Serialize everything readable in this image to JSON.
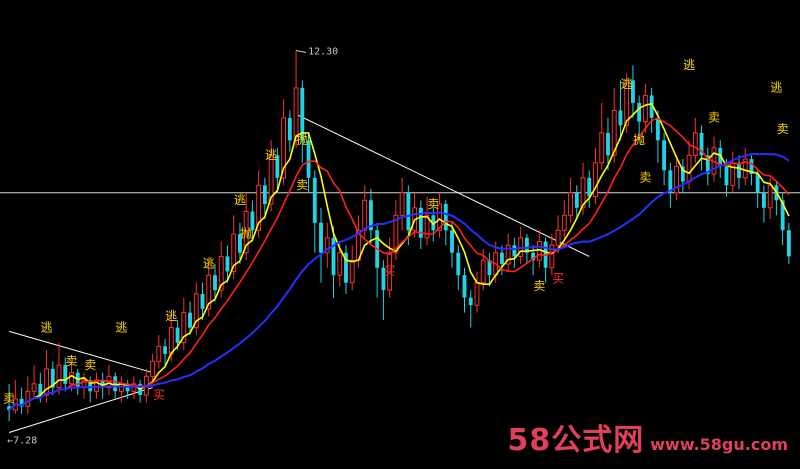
{
  "chart_data": {
    "type": "candlestick",
    "title": "",
    "high_label": "12.30",
    "low_label": "←7.28",
    "ylim": [
      7.1,
      12.6
    ],
    "reference_price": 10.4,
    "colors": {
      "background": "#000000",
      "up_candle": "#ff3030",
      "down_candle": "#22d3e6",
      "ma_fast": "#ffff00",
      "ma_mid": "#ff2020",
      "ma_slow": "#2430ff",
      "trend_line": "#ffffff",
      "signal_sell": "#ffd700",
      "signal_buy": "#ff3030"
    },
    "candles": [
      [
        7.55,
        7.5,
        7.85,
        7.35
      ],
      [
        7.5,
        7.65,
        7.9,
        7.45
      ],
      [
        7.65,
        7.55,
        7.8,
        7.45
      ],
      [
        7.55,
        7.75,
        7.95,
        7.45
      ],
      [
        7.75,
        7.85,
        8.1,
        7.65
      ],
      [
        7.85,
        7.7,
        8.0,
        7.6
      ],
      [
        7.7,
        8.05,
        8.3,
        7.6
      ],
      [
        8.05,
        7.8,
        8.15,
        7.7
      ],
      [
        7.8,
        8.1,
        8.4,
        7.7
      ],
      [
        8.1,
        7.85,
        8.2,
        7.75
      ],
      [
        7.85,
        8.0,
        8.15,
        7.75
      ],
      [
        8.0,
        7.8,
        8.05,
        7.7
      ],
      [
        7.8,
        7.9,
        8.0,
        7.65
      ],
      [
        7.9,
        7.75,
        7.95,
        7.6
      ],
      [
        7.75,
        7.9,
        8.0,
        7.65
      ],
      [
        7.9,
        7.8,
        8.0,
        7.65
      ],
      [
        7.8,
        7.95,
        8.1,
        7.7
      ],
      [
        7.95,
        7.75,
        8.0,
        7.65
      ],
      [
        7.75,
        7.85,
        7.95,
        7.6
      ],
      [
        7.85,
        7.75,
        7.9,
        7.65
      ],
      [
        7.75,
        7.85,
        7.95,
        7.65
      ],
      [
        7.85,
        7.7,
        7.9,
        7.6
      ],
      [
        7.7,
        7.95,
        8.05,
        7.6
      ],
      [
        7.95,
        8.15,
        8.25,
        7.85
      ],
      [
        8.15,
        8.35,
        8.5,
        8.05
      ],
      [
        8.35,
        8.25,
        8.45,
        8.1
      ],
      [
        8.25,
        8.6,
        8.75,
        8.15
      ],
      [
        8.6,
        8.4,
        8.7,
        8.3
      ],
      [
        8.4,
        8.8,
        9.0,
        8.3
      ],
      [
        8.8,
        8.6,
        8.95,
        8.5
      ],
      [
        8.6,
        9.05,
        9.2,
        8.5
      ],
      [
        9.05,
        8.85,
        9.2,
        8.7
      ],
      [
        8.85,
        9.3,
        9.5,
        8.75
      ],
      [
        9.3,
        9.1,
        9.45,
        8.95
      ],
      [
        9.1,
        9.55,
        9.75,
        9.0
      ],
      [
        9.55,
        9.35,
        9.7,
        9.2
      ],
      [
        9.35,
        9.85,
        10.1,
        9.25
      ],
      [
        9.85,
        9.6,
        10.0,
        9.45
      ],
      [
        9.6,
        10.15,
        10.4,
        9.5
      ],
      [
        10.15,
        9.9,
        10.3,
        9.75
      ],
      [
        9.9,
        10.5,
        10.7,
        9.8
      ],
      [
        10.5,
        10.25,
        10.6,
        10.05
      ],
      [
        10.25,
        10.9,
        11.1,
        10.15
      ],
      [
        10.9,
        10.6,
        11.0,
        10.4
      ],
      [
        10.6,
        11.4,
        11.65,
        10.5
      ],
      [
        11.4,
        11.1,
        11.5,
        10.95
      ],
      [
        11.1,
        11.8,
        12.3,
        11.0
      ],
      [
        11.8,
        11.1,
        11.9,
        10.8
      ],
      [
        11.1,
        10.6,
        11.2,
        10.4
      ],
      [
        10.6,
        10.0,
        10.7,
        9.6
      ],
      [
        10.0,
        9.6,
        10.2,
        9.2
      ],
      [
        9.6,
        9.8,
        10.0,
        9.4
      ],
      [
        9.8,
        9.3,
        9.95,
        9.0
      ],
      [
        9.3,
        9.6,
        9.75,
        9.15
      ],
      [
        9.6,
        9.2,
        9.7,
        9.05
      ],
      [
        9.2,
        9.5,
        9.7,
        9.1
      ],
      [
        9.5,
        9.9,
        10.1,
        9.4
      ],
      [
        9.9,
        10.3,
        10.5,
        9.8
      ],
      [
        10.3,
        9.9,
        10.45,
        9.7
      ],
      [
        9.9,
        9.4,
        10.0,
        9.0
      ],
      [
        9.4,
        9.1,
        9.5,
        8.7
      ],
      [
        9.1,
        9.6,
        9.8,
        9.0
      ],
      [
        9.6,
        10.1,
        10.3,
        9.5
      ],
      [
        10.1,
        10.4,
        10.6,
        9.9
      ],
      [
        10.4,
        9.9,
        10.5,
        9.7
      ],
      [
        9.9,
        10.2,
        10.4,
        9.8
      ],
      [
        10.2,
        9.8,
        10.3,
        9.65
      ],
      [
        9.8,
        10.1,
        10.35,
        9.7
      ],
      [
        10.1,
        9.9,
        10.2,
        9.75
      ],
      [
        9.9,
        10.25,
        10.4,
        9.8
      ],
      [
        10.25,
        9.9,
        10.3,
        9.7
      ],
      [
        9.9,
        9.6,
        10.0,
        9.4
      ],
      [
        9.6,
        9.3,
        9.7,
        9.1
      ],
      [
        9.3,
        9.0,
        9.4,
        8.8
      ],
      [
        9.0,
        8.9,
        9.1,
        8.6
      ],
      [
        8.9,
        9.2,
        9.35,
        8.8
      ],
      [
        9.2,
        9.5,
        9.65,
        9.1
      ],
      [
        9.5,
        9.3,
        9.6,
        9.15
      ],
      [
        9.3,
        9.6,
        9.75,
        9.2
      ],
      [
        9.6,
        9.45,
        9.7,
        9.3
      ],
      [
        9.45,
        9.7,
        9.85,
        9.35
      ],
      [
        9.7,
        9.55,
        9.8,
        9.4
      ],
      [
        9.55,
        9.8,
        9.95,
        9.45
      ],
      [
        9.8,
        9.6,
        9.85,
        9.45
      ],
      [
        9.6,
        9.5,
        9.7,
        9.3
      ],
      [
        9.5,
        9.75,
        9.9,
        9.4
      ],
      [
        9.75,
        9.4,
        9.8,
        9.2
      ],
      [
        9.4,
        9.7,
        9.85,
        9.3
      ],
      [
        9.7,
        9.9,
        10.1,
        9.6
      ],
      [
        9.9,
        10.1,
        10.3,
        9.8
      ],
      [
        10.1,
        10.4,
        10.6,
        10.0
      ],
      [
        10.4,
        10.2,
        10.5,
        10.05
      ],
      [
        10.2,
        10.6,
        10.8,
        10.1
      ],
      [
        10.6,
        10.35,
        10.7,
        10.2
      ],
      [
        10.35,
        10.8,
        11.0,
        10.25
      ],
      [
        10.8,
        11.2,
        11.6,
        10.7
      ],
      [
        11.2,
        10.9,
        11.4,
        10.7
      ],
      [
        10.9,
        11.5,
        11.8,
        10.8
      ],
      [
        11.5,
        11.3,
        11.9,
        11.1
      ],
      [
        11.3,
        11.9,
        12.0,
        11.2
      ],
      [
        11.9,
        11.6,
        12.1,
        11.4
      ],
      [
        11.6,
        11.35,
        11.7,
        11.1
      ],
      [
        11.35,
        11.7,
        11.85,
        11.2
      ],
      [
        11.7,
        11.4,
        11.8,
        11.2
      ],
      [
        11.4,
        11.1,
        11.5,
        10.8
      ],
      [
        11.1,
        10.7,
        11.2,
        10.5
      ],
      [
        10.7,
        10.4,
        10.8,
        10.2
      ],
      [
        10.4,
        10.75,
        10.9,
        10.3
      ],
      [
        10.75,
        10.55,
        10.85,
        10.4
      ],
      [
        10.55,
        10.9,
        11.1,
        10.45
      ],
      [
        10.9,
        11.2,
        11.4,
        10.8
      ],
      [
        11.2,
        10.9,
        11.3,
        10.7
      ],
      [
        10.9,
        10.65,
        11.0,
        10.5
      ],
      [
        10.65,
        11.0,
        11.15,
        10.55
      ],
      [
        11.0,
        10.75,
        11.1,
        10.6
      ],
      [
        10.75,
        10.5,
        10.85,
        10.35
      ],
      [
        10.5,
        10.8,
        10.95,
        10.4
      ],
      [
        10.8,
        10.6,
        10.9,
        10.45
      ],
      [
        10.6,
        10.85,
        11.0,
        10.5
      ],
      [
        10.85,
        10.65,
        10.9,
        10.5
      ],
      [
        10.65,
        10.4,
        10.7,
        10.2
      ],
      [
        10.4,
        10.2,
        10.5,
        10.0
      ],
      [
        10.2,
        10.5,
        10.6,
        10.05
      ],
      [
        10.5,
        10.3,
        10.55,
        10.1
      ],
      [
        10.3,
        9.9,
        10.4,
        9.7
      ],
      [
        9.9,
        9.55,
        10.0,
        9.45
      ]
    ],
    "moving_averages": [
      {
        "name": "",
        "color": "#ffff00",
        "period": 5
      },
      {
        "name": "",
        "color": "#ff2020",
        "period": 10
      },
      {
        "name": "",
        "color": "#2430ff",
        "period": 30
      }
    ],
    "trend_lines": [
      {
        "from": [
          0,
          8.55
        ],
        "to": [
          23,
          8.0
        ]
      },
      {
        "from": [
          0,
          7.2
        ],
        "to": [
          23,
          7.8
        ]
      },
      {
        "from": [
          46,
          11.45
        ],
        "to": [
          93,
          9.55
        ]
      }
    ],
    "signals": [
      {
        "text": "卖",
        "index": 0,
        "price": 7.6,
        "kind": "sell"
      },
      {
        "text": "逃",
        "index": 6,
        "price": 8.55,
        "kind": "sell"
      },
      {
        "text": "卖",
        "index": 10,
        "price": 8.1,
        "kind": "sell"
      },
      {
        "text": "卖",
        "index": 13,
        "price": 8.05,
        "kind": "sell"
      },
      {
        "text": "逃",
        "index": 18,
        "price": 8.55,
        "kind": "sell"
      },
      {
        "text": "买",
        "index": 24,
        "price": 7.65,
        "kind": "buy"
      },
      {
        "text": "逃",
        "index": 26,
        "price": 8.7,
        "kind": "sell"
      },
      {
        "text": "逃",
        "index": 32,
        "price": 9.4,
        "kind": "sell"
      },
      {
        "text": "抛",
        "index": 38,
        "price": 9.8,
        "kind": "sell"
      },
      {
        "text": "逃",
        "index": 37,
        "price": 10.25,
        "kind": "sell"
      },
      {
        "text": "逃",
        "index": 42,
        "price": 10.85,
        "kind": "sell"
      },
      {
        "text": "抛",
        "index": 47,
        "price": 11.05,
        "kind": "sell"
      },
      {
        "text": "卖",
        "index": 47,
        "price": 10.45,
        "kind": "sell"
      },
      {
        "text": "买",
        "index": 61,
        "price": 9.3,
        "kind": "buy"
      },
      {
        "text": "卖",
        "index": 68,
        "price": 10.2,
        "kind": "sell"
      },
      {
        "text": "卖",
        "index": 85,
        "price": 9.1,
        "kind": "sell"
      },
      {
        "text": "买",
        "index": 88,
        "price": 9.2,
        "kind": "buy"
      },
      {
        "text": "逃",
        "index": 99,
        "price": 11.8,
        "kind": "sell"
      },
      {
        "text": "抛",
        "index": 101,
        "price": 11.05,
        "kind": "sell"
      },
      {
        "text": "卖",
        "index": 102,
        "price": 10.55,
        "kind": "sell"
      },
      {
        "text": "逃",
        "index": 109,
        "price": 12.05,
        "kind": "sell"
      },
      {
        "text": "卖",
        "index": 113,
        "price": 11.35,
        "kind": "sell"
      },
      {
        "text": "逃",
        "index": 123,
        "price": 11.75,
        "kind": "sell"
      },
      {
        "text": "卖",
        "index": 124,
        "price": 11.2,
        "kind": "sell"
      }
    ]
  },
  "watermark": {
    "brand": "58公式网",
    "url": "www.58gu.com"
  }
}
